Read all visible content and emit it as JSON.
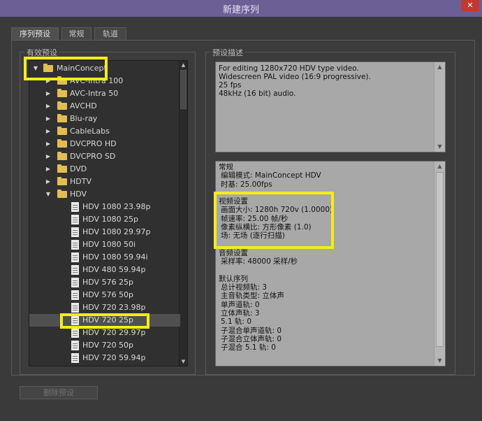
{
  "window": {
    "title": "新建序列",
    "close_glyph": "✕"
  },
  "tabs": [
    {
      "label": "序列预设",
      "active": true
    },
    {
      "label": "常规",
      "active": false
    },
    {
      "label": "轨道",
      "active": false
    }
  ],
  "presets_group": {
    "legend": "有效预设",
    "tree": [
      {
        "label": "MainConcept",
        "type": "folder",
        "expanded": true,
        "level": 0
      },
      {
        "label": "AVC-Intra 100",
        "type": "folder",
        "expanded": false,
        "level": 1
      },
      {
        "label": "AVC-Intra 50",
        "type": "folder",
        "expanded": false,
        "level": 1
      },
      {
        "label": "AVCHD",
        "type": "folder",
        "expanded": false,
        "level": 1
      },
      {
        "label": "Blu-ray",
        "type": "folder",
        "expanded": false,
        "level": 1
      },
      {
        "label": "CableLabs",
        "type": "folder",
        "expanded": false,
        "level": 1
      },
      {
        "label": "DVCPRO HD",
        "type": "folder",
        "expanded": false,
        "level": 1
      },
      {
        "label": "DVCPRO SD",
        "type": "folder",
        "expanded": false,
        "level": 1
      },
      {
        "label": "DVD",
        "type": "folder",
        "expanded": false,
        "level": 1
      },
      {
        "label": "HDTV",
        "type": "folder",
        "expanded": false,
        "level": 1
      },
      {
        "label": "HDV",
        "type": "folder",
        "expanded": true,
        "level": 1
      },
      {
        "label": "HDV 1080 23.98p",
        "type": "preset",
        "level": 2
      },
      {
        "label": "HDV 1080 25p",
        "type": "preset",
        "level": 2
      },
      {
        "label": "HDV 1080 29.97p",
        "type": "preset",
        "level": 2
      },
      {
        "label": "HDV 1080 50i",
        "type": "preset",
        "level": 2
      },
      {
        "label": "HDV 1080 59.94i",
        "type": "preset",
        "level": 2
      },
      {
        "label": "HDV 480 59.94p",
        "type": "preset",
        "level": 2
      },
      {
        "label": "HDV 576 25p",
        "type": "preset",
        "level": 2
      },
      {
        "label": "HDV 576 50p",
        "type": "preset",
        "level": 2
      },
      {
        "label": "HDV 720 23.98p",
        "type": "preset",
        "level": 2
      },
      {
        "label": "HDV 720 25p",
        "type": "preset",
        "level": 2,
        "selected": true
      },
      {
        "label": "HDV 720 29.97p",
        "type": "preset",
        "level": 2
      },
      {
        "label": "HDV 720 50p",
        "type": "preset",
        "level": 2
      },
      {
        "label": "HDV 720 59.94p",
        "type": "preset",
        "level": 2
      }
    ]
  },
  "description_group": {
    "legend": "预设描述",
    "description_lines": [
      "For editing 1280x720 HDV type video.",
      "Widescreen PAL video (16:9 progressive).",
      "25 fps",
      "48kHz (16 bit) audio."
    ],
    "info_lines": [
      {
        "text": "常规",
        "indent": false
      },
      {
        "text": "编辑模式: MainConcept HDV",
        "indent": true
      },
      {
        "text": "时基: 25.00fps",
        "indent": true
      },
      {
        "text": "",
        "indent": false
      },
      {
        "text": "视频设置",
        "indent": false
      },
      {
        "text": "画面大小: 1280h 720v (1.0000)",
        "indent": true
      },
      {
        "text": "帧速率: 25.00 帧/秒",
        "indent": true
      },
      {
        "text": "像素纵横比: 方形像素 (1.0)",
        "indent": true
      },
      {
        "text": "场: 无场 (逐行扫描)",
        "indent": true
      },
      {
        "text": "",
        "indent": false
      },
      {
        "text": "音频设置",
        "indent": false
      },
      {
        "text": "采样率: 48000 采样/秒",
        "indent": true
      },
      {
        "text": "",
        "indent": false
      },
      {
        "text": "默认序列",
        "indent": false
      },
      {
        "text": "总计视频轨: 3",
        "indent": true
      },
      {
        "text": "主音轨类型: 立体声",
        "indent": true
      },
      {
        "text": "单声道轨: 0",
        "indent": true
      },
      {
        "text": "立体声轨: 3",
        "indent": true
      },
      {
        "text": "5.1 轨: 0",
        "indent": true
      },
      {
        "text": "子混合单声道轨: 0",
        "indent": true
      },
      {
        "text": "子混合立体声轨: 0",
        "indent": true
      },
      {
        "text": "子混合 5.1 轨: 0",
        "indent": true
      }
    ]
  },
  "delete_preset_label": "删除预设",
  "colors": {
    "titlebar": "#6b5f95",
    "close": "#c03a32",
    "highlight": "#f4ec1a",
    "folder": "#e2bd55"
  },
  "icons": {
    "expanded": "chevron-down-icon",
    "collapsed": "chevron-right-icon",
    "folder": "folder-icon",
    "preset": "preset-file-icon"
  }
}
